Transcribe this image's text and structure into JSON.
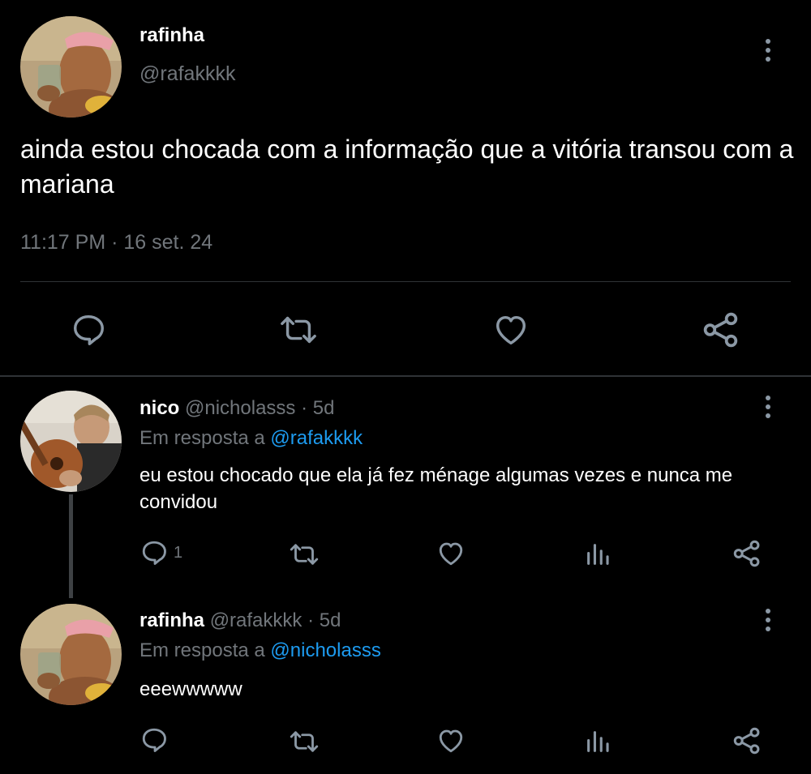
{
  "main_tweet": {
    "author_name": "rafinha",
    "author_handle": "@rafakkkk",
    "text": "ainda estou chocada com a informação que a vitória transou com a mariana",
    "timestamp": "11:17 PM · 16 set. 24",
    "actions": [
      "reply-icon",
      "retweet-icon",
      "like-icon",
      "share-icon"
    ]
  },
  "replies": [
    {
      "author_name": "nico",
      "author_handle": "@nicholasss",
      "time": "· 5d",
      "reply_prefix": "Em resposta a",
      "reply_to": "@rafakkkk",
      "text": "eu estou chocado que ela já fez ménage algumas vezes e nunca me convidou",
      "reply_count": "1"
    },
    {
      "author_name": "rafinha",
      "author_handle": "@rafakkkk",
      "time": "· 5d",
      "reply_prefix": "Em resposta a",
      "reply_to": "@nicholasss",
      "text": "eeewwwww",
      "reply_count": ""
    }
  ],
  "colors": {
    "background": "#000000",
    "text": "#e7e9ea",
    "muted": "#71767b",
    "link": "#1d9bf0",
    "divider": "#2f3336",
    "icon": "#8b98a5"
  }
}
